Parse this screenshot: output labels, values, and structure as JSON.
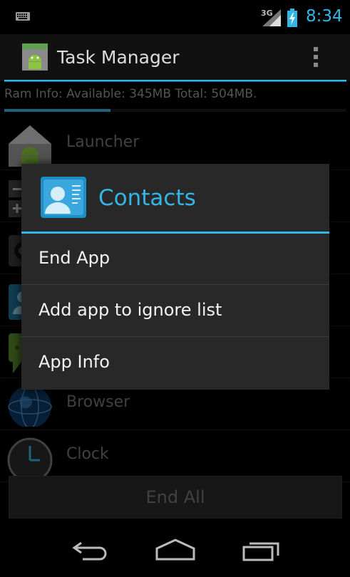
{
  "status_bar": {
    "network": "3G",
    "time": "8:34"
  },
  "action_bar": {
    "title": "Task Manager"
  },
  "ram_info": {
    "text": "Ram Info: Available: 345MB Total: 504MB.",
    "used_fraction": 0.31
  },
  "apps": [
    {
      "label": "Launcher",
      "icon": "android-home-icon"
    },
    {
      "label": "",
      "icon": "zoom-controls-icon"
    },
    {
      "label": "",
      "icon": "camera-icon"
    },
    {
      "label": "",
      "icon": "contacts-icon"
    },
    {
      "label": "",
      "icon": "messaging-icon"
    },
    {
      "label": "Browser",
      "icon": "globe-icon"
    },
    {
      "label": "Clock",
      "icon": "clock-icon"
    }
  ],
  "end_all_label": "End All",
  "dialog": {
    "title": "Contacts",
    "items": [
      "End App",
      "Add app to ignore list",
      "App Info"
    ]
  },
  "colors": {
    "accent": "#33b5e5",
    "background": "#000000",
    "dialog": "#282828"
  }
}
